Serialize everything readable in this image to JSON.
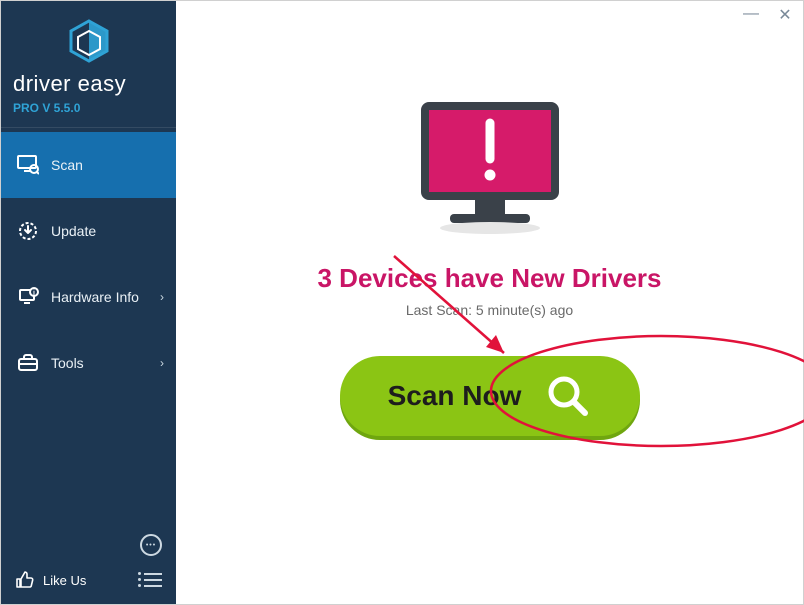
{
  "brand": {
    "name": "driver easy",
    "version": "PRO V 5.5.0"
  },
  "nav": {
    "scan": "Scan",
    "update": "Update",
    "hardware": "Hardware Info",
    "tools": "Tools"
  },
  "footer": {
    "like": "Like Us"
  },
  "main": {
    "status_title": "3 Devices have New Drivers",
    "status_sub": "Last Scan: 5 minute(s) ago",
    "scan_button": "Scan Now"
  },
  "colors": {
    "sidebar_bg": "#1d3752",
    "active_bg": "#166fae",
    "accent_pink": "#c91566",
    "scan_green": "#8bc514"
  }
}
